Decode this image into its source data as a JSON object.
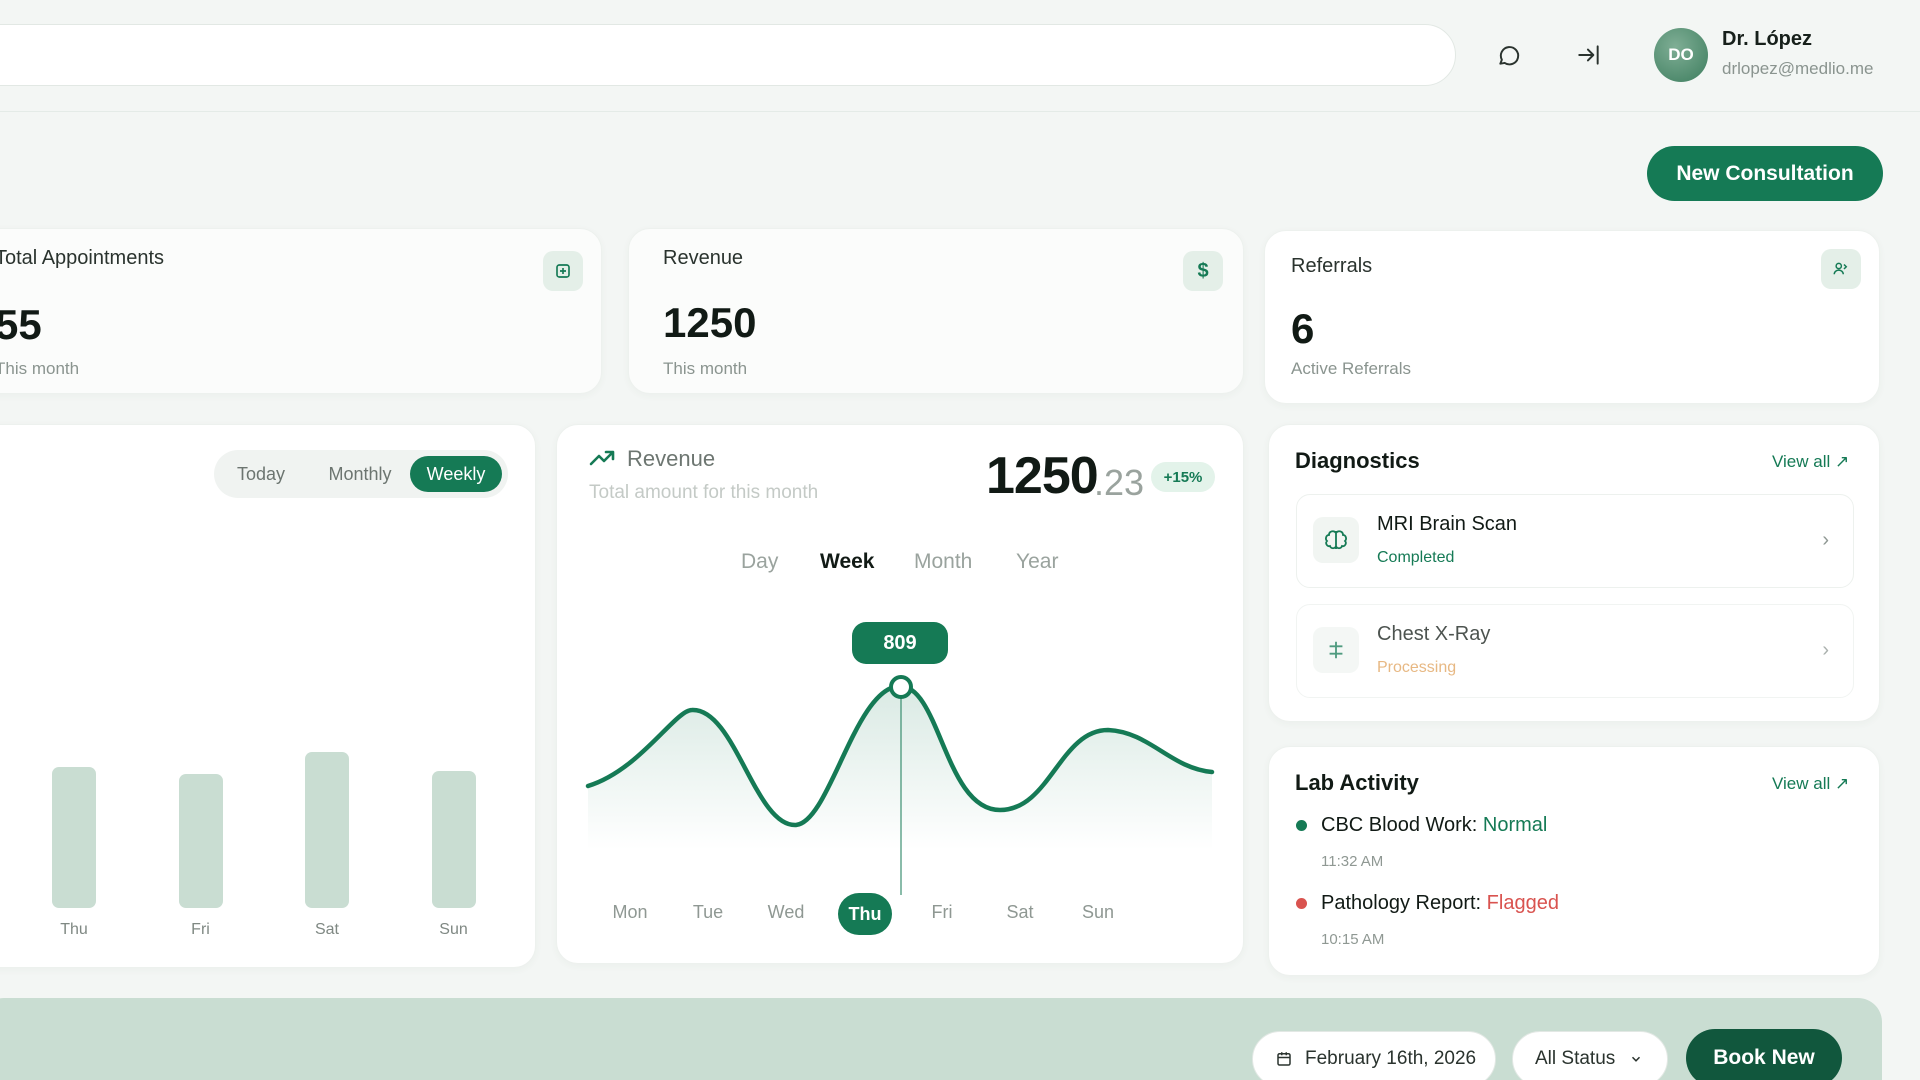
{
  "header": {
    "user": {
      "initials": "DO",
      "name": "Dr. López",
      "email": "drlopez@medlio.me"
    },
    "icons": [
      "chat-icon",
      "logout-icon"
    ]
  },
  "actions": {
    "new_consultation": "New Consultation"
  },
  "stats": {
    "appointments": {
      "label": "Total Appointments",
      "value": "55",
      "sub": "This month",
      "icon": "calendar-plus-icon"
    },
    "revenue": {
      "label": "Revenue",
      "value": "1250",
      "sub": "This month",
      "icon": "dollar-icon"
    },
    "referrals": {
      "label": "Referrals",
      "value": "6",
      "sub": "Active Referrals",
      "icon": "user-share-icon"
    }
  },
  "appointments_chart": {
    "segments": [
      "Today",
      "Monthly",
      "Weekly"
    ],
    "active_segment": "Weekly"
  },
  "chart_data": {
    "type": "bar",
    "categories": [
      "Thu",
      "Fri",
      "Sat",
      "Sun"
    ],
    "values": [
      112,
      106,
      124,
      109
    ],
    "title": "",
    "xlabel": "",
    "ylabel": "",
    "grid": false
  },
  "revenue_chart": {
    "title": "Revenue",
    "subtitle": "Total amount for this month",
    "amount_int": "1250",
    "amount_dec": ".23",
    "change": "+15%",
    "periods": [
      "Day",
      "Week",
      "Month",
      "Year"
    ],
    "active_period": "Week",
    "days": [
      "Mon",
      "Tue",
      "Wed",
      "Thu",
      "Fri",
      "Sat",
      "Sun"
    ],
    "active_day": "Thu",
    "tooltip": "809",
    "accent": "#157a55"
  },
  "diagnostics": {
    "title": "Diagnostics",
    "view_all": "View all",
    "items": [
      {
        "name": "MRI Brain Scan",
        "status": "Completed",
        "status_color": "#157a55",
        "icon": "brain-icon"
      },
      {
        "name": "Chest X-Ray",
        "status": "Processing",
        "status_color": "#e0a15a",
        "icon": "plus-medical-icon"
      }
    ]
  },
  "lab_activity": {
    "title": "Lab Activity",
    "view_all": "View all",
    "items": [
      {
        "test": "CBC Blood Work:",
        "result": "Normal",
        "result_color": "#157a55",
        "dot_color": "#157a55",
        "time": "11:32 AM"
      },
      {
        "test": "Pathology Report:",
        "result": "Flagged",
        "result_color": "#d9534f",
        "dot_color": "#d9534f",
        "time": "10:15 AM"
      }
    ]
  },
  "bottom_bar": {
    "date": "February 16th, 2026",
    "status_filter": "All Status",
    "book_new": "Book New"
  }
}
